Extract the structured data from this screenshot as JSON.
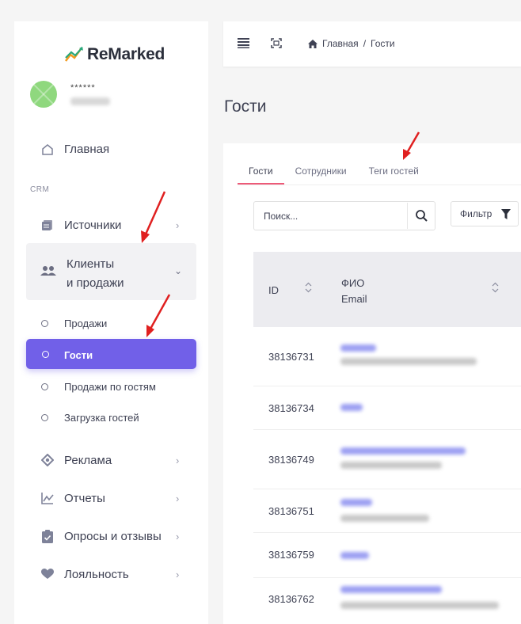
{
  "app": {
    "logo_text": "ReMarked"
  },
  "user": {
    "name": "******"
  },
  "sidebar": {
    "home_label": "Главная",
    "section_crm": "CRM",
    "sources_label": "Источники",
    "clients_label_line1": "Клиенты",
    "clients_label_line2": "и продажи",
    "sub_items": [
      "Продажи",
      "Гости",
      "Продажи по гостям",
      "Загрузка гостей"
    ],
    "ads_label": "Реклама",
    "reports_label": "Отчеты",
    "surveys_label": "Опросы и отзывы",
    "loyalty_label": "Лояльность"
  },
  "breadcrumb": {
    "home": "Главная",
    "separator": "/",
    "current": "Гости"
  },
  "page": {
    "title": "Гости"
  },
  "tabs": [
    "Гости",
    "Сотрудники",
    "Теги гостей"
  ],
  "search": {
    "placeholder": "Поиск..."
  },
  "filter": {
    "label": "Фильтр"
  },
  "table": {
    "headers": {
      "id": "ID",
      "fio": "ФИО",
      "email": "Email"
    },
    "rows": [
      {
        "id": "38136731"
      },
      {
        "id": "38136734"
      },
      {
        "id": "38136749"
      },
      {
        "id": "38136751"
      },
      {
        "id": "38136759"
      },
      {
        "id": "38136762"
      }
    ]
  },
  "colors": {
    "accent": "#7160e8",
    "tab_active": "#ed5a78",
    "annotation_arrow": "#e02020"
  }
}
